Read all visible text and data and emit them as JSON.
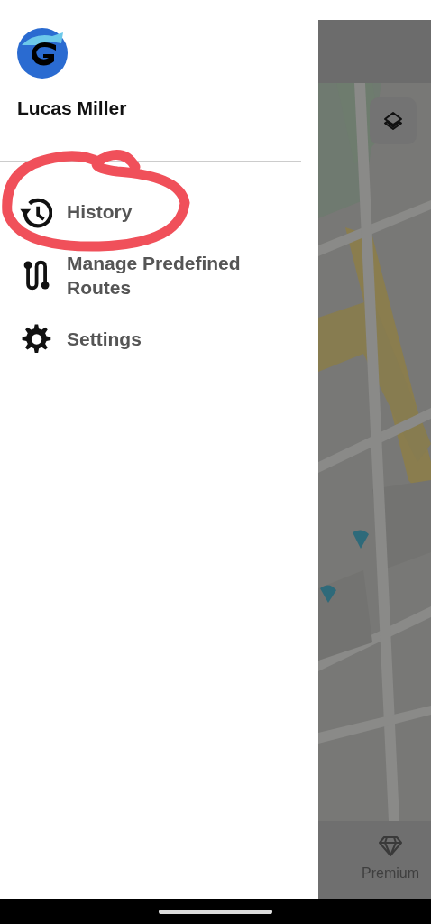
{
  "user": {
    "name": "Lucas Miller"
  },
  "menu": [
    {
      "kind": "history",
      "label": "History"
    },
    {
      "kind": "routes",
      "label": "Manage Predefined Routes"
    },
    {
      "kind": "settings",
      "label": "Settings"
    }
  ],
  "bottom_nav": [
    {
      "kind": "premium",
      "label": "Premium"
    }
  ]
}
